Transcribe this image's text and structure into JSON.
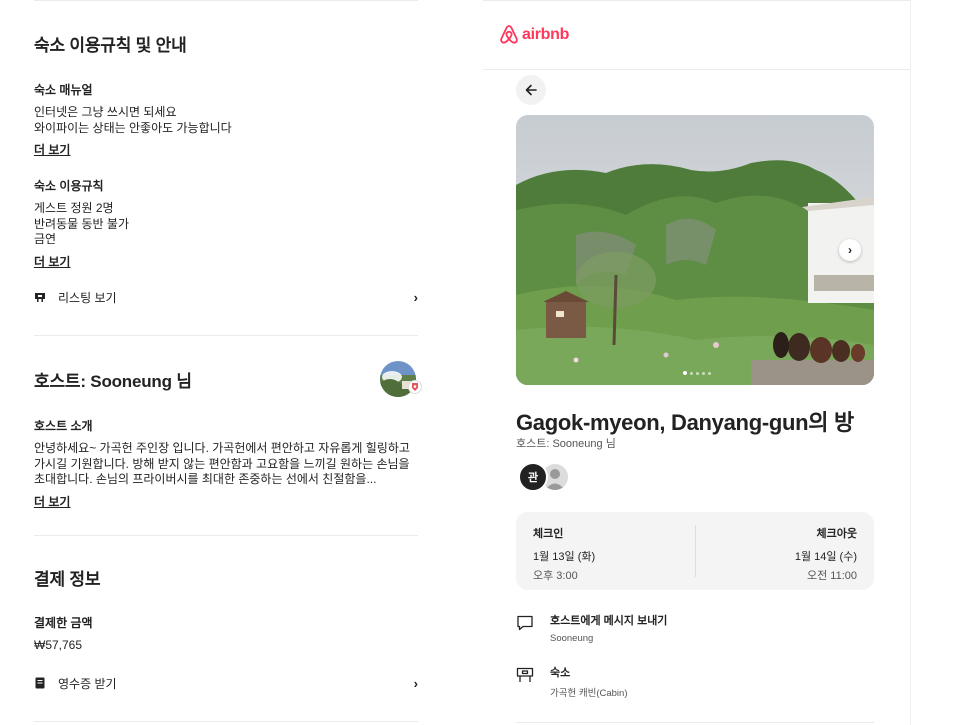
{
  "house_rules": {
    "title": "숙소 이용규칙 및 안내",
    "manual": {
      "heading": "숙소 매뉴얼",
      "line1": "인터넷은 그냥 쓰시면 되세요",
      "line2": "와이파이는 상태는 안좋아도 가능합니다",
      "more": "더 보기"
    },
    "rules": {
      "heading": "숙소 이용규칙",
      "line1": "게스트 정원 2명",
      "line2": "반려동물 동반 불가",
      "line3": "금연",
      "more": "더 보기"
    },
    "view_listing": "리스팅 보기"
  },
  "host": {
    "title": "호스트: Sooneung 님",
    "intro_heading": "호스트 소개",
    "intro_line1": "안녕하세요~ 가곡헌 주인장 입니다. 가곡헌에서 편안하고 자유롭게 힐링하고",
    "intro_line2": "가시길 기원합니다. 방해 받지 않는 편안함과 고요함을 느끼길 원하는 손님을",
    "intro_line3": "초대합니다. 손님의 프라이버시를 최대한 존중하는 선에서 친절함을...",
    "more": "더 보기"
  },
  "payment": {
    "title": "결제 정보",
    "paid_heading": "결제한 금액",
    "paid_amount": "₩57,765",
    "receipt": "영수증 받기"
  },
  "panel": {
    "brand": "airbnb",
    "brand_color": "#ff385c",
    "listing_title": "Gagok-myeon, Danyang-gun의 방",
    "listing_sub": "호스트: Sooneung 님",
    "host_initial": "관",
    "checkin": {
      "label": "체크인",
      "date": "1월 13일 (화)",
      "time": "오후 3:00"
    },
    "checkout": {
      "label": "체크아웃",
      "date": "1월 14일 (수)",
      "time": "오전 11:00"
    },
    "message": {
      "title": "호스트에게 메시지 보내기",
      "sub": "Sooneung"
    },
    "stay": {
      "title": "숙소",
      "sub": "가곡헌 캐빈(Cabin)"
    }
  }
}
